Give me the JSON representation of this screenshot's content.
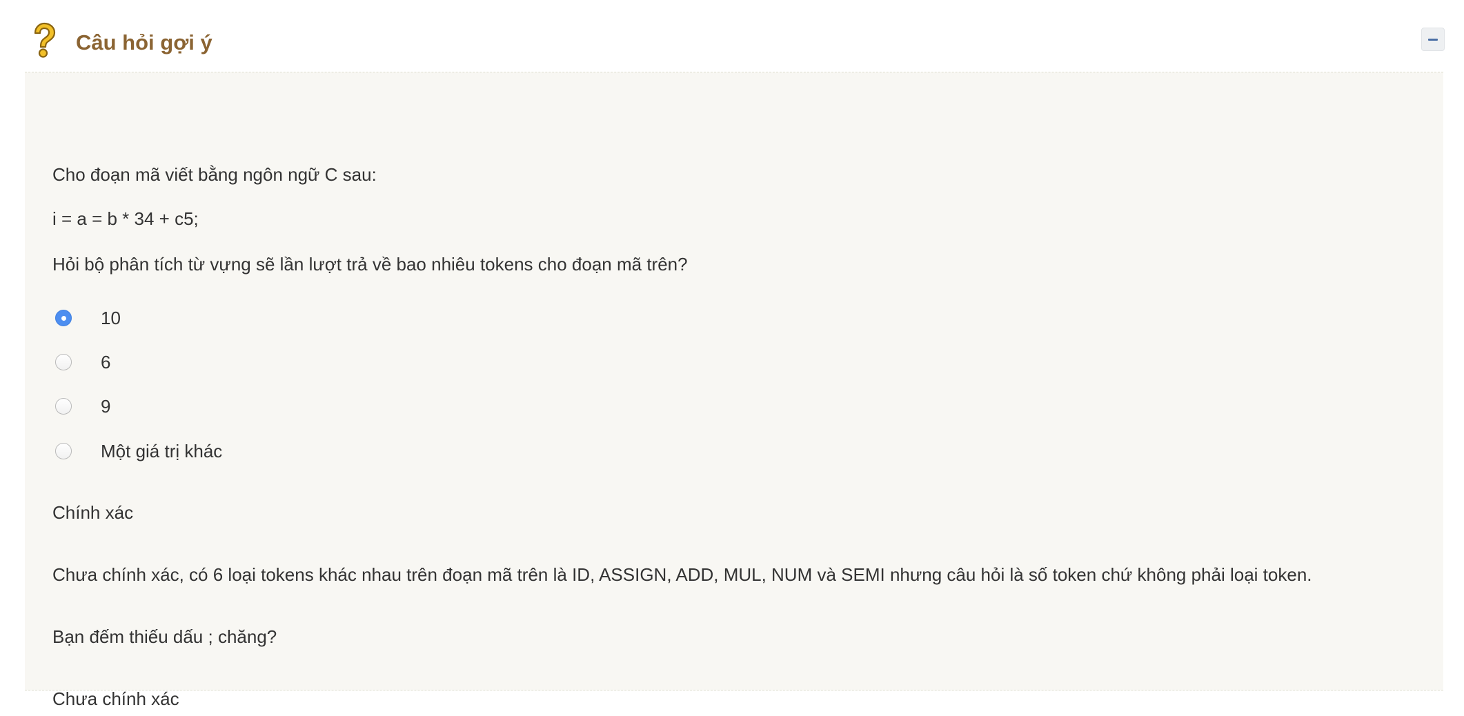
{
  "header": {
    "title": "Câu hỏi gợi ý",
    "icon": "question-mark-icon",
    "accent_color": "#8b6433"
  },
  "question": {
    "intro": "Cho đoạn mã viết bằng ngôn ngữ C sau:",
    "code": "i = a = b * 34 + c5;",
    "prompt": "Hỏi bộ phân tích từ vựng sẽ lần lượt trả về bao nhiêu tokens cho đoạn mã trên?",
    "options": [
      {
        "label": "10",
        "selected": true
      },
      {
        "label": "6",
        "selected": false
      },
      {
        "label": "9",
        "selected": false
      },
      {
        "label": "Một giá trị khác",
        "selected": false
      }
    ]
  },
  "feedback": [
    "Chính xác",
    "Chưa chính xác, có 6 loại tokens khác nhau trên đoạn mã trên là ID, ASSIGN, ADD, MUL, NUM và SEMI nhưng câu hỏi là số token chứ không phải loại token.",
    "Bạn đếm thiếu dấu ; chăng?",
    "Chưa chính xác"
  ]
}
